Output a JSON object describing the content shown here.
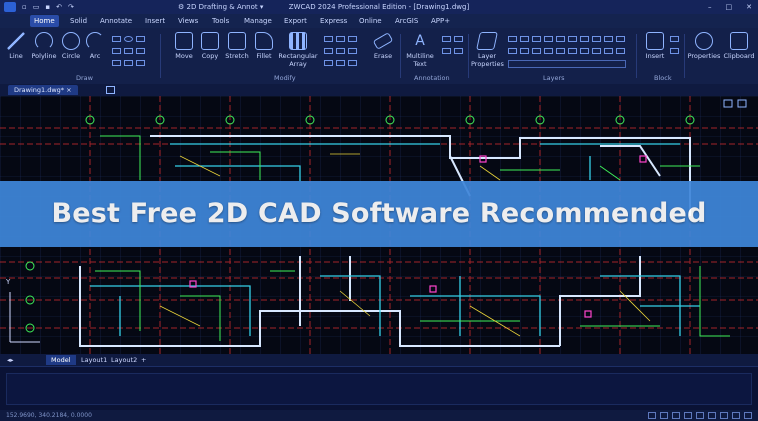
{
  "title_bar": {
    "workspace": "2D Drafting & Annot",
    "title": "ZWCAD 2024 Professional Edition - [Drawing1.dwg]",
    "window_controls": [
      "–",
      "□",
      "✕"
    ]
  },
  "menu_tabs": [
    "Home",
    "Solid",
    "Annotate",
    "Insert",
    "Views",
    "Tools",
    "Manage",
    "Export",
    "Express",
    "Online",
    "ArcGIS",
    "APP+"
  ],
  "ribbon": {
    "draw_tools": [
      "Line",
      "Polyline",
      "Circle",
      "Arc"
    ],
    "modify_tools": [
      "Move",
      "Copy",
      "Stretch",
      "Fillet"
    ],
    "rect_array": [
      "Rectangular",
      "Array"
    ],
    "annotation_tools": [
      "Erase",
      "Multiline",
      "Text"
    ],
    "layer_tool": [
      "Layer",
      "Properties"
    ],
    "block_tool": "Insert",
    "properties_tool": "Properties",
    "clipboard_tool": "Clipboard",
    "groups": [
      "Draw",
      "Modify",
      "Annotation",
      "Layers",
      "Block"
    ]
  },
  "document_tab": "Drawing1.dwg*",
  "banner_text": "Best Free 2D CAD Software Recommended",
  "ucs_label": "Y",
  "layout_tabs": [
    "Model",
    "Layout1",
    "Layout2",
    "+"
  ],
  "status": {
    "coords": "152.9690, 340.2184, 0.0000"
  },
  "colors": {
    "banner": "#3f86d9",
    "ribbon": "#13204a",
    "canvas": "#050813",
    "accent": "#2a4ca8"
  }
}
